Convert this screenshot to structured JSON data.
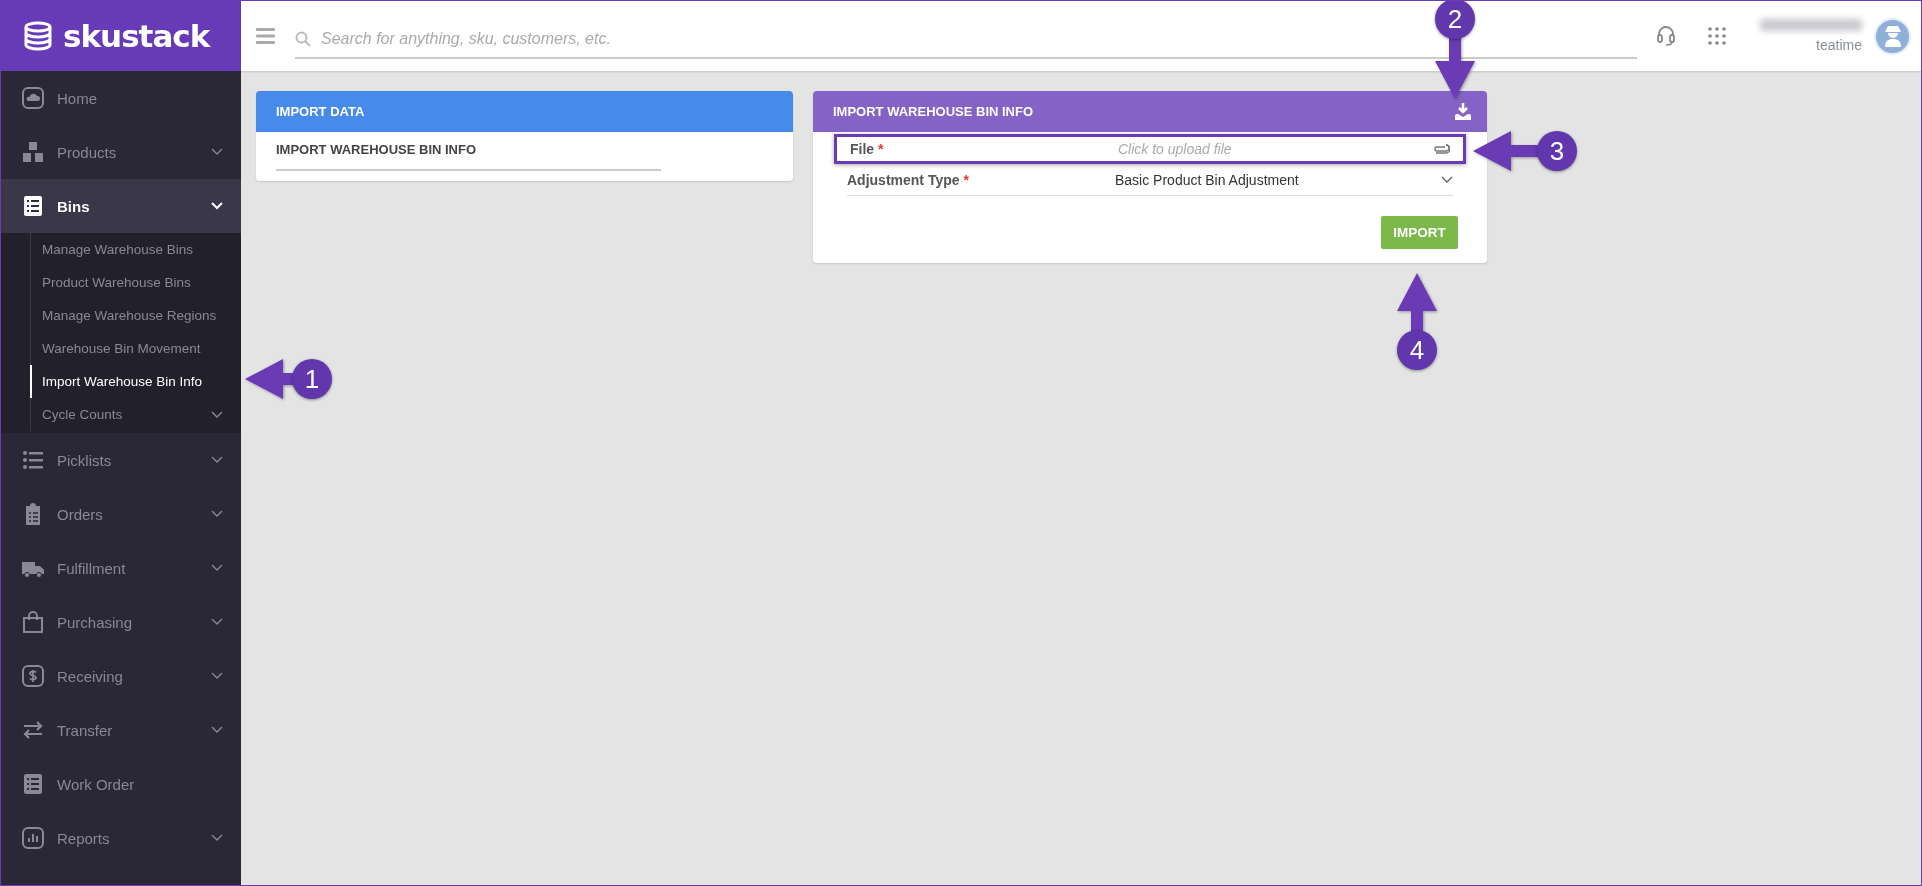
{
  "sidebar": {
    "logo": "skustack",
    "items": [
      {
        "label": "Home",
        "kind": "home",
        "expandable": false,
        "expanded": false
      },
      {
        "label": "Products",
        "kind": "products",
        "expandable": true,
        "expanded": false
      },
      {
        "label": "Bins",
        "kind": "bins",
        "expandable": true,
        "expanded": true,
        "children": [
          {
            "label": "Manage Warehouse Bins",
            "selected": false,
            "expandable": false
          },
          {
            "label": "Product Warehouse Bins",
            "selected": false,
            "expandable": false
          },
          {
            "label": "Manage Warehouse Regions",
            "selected": false,
            "expandable": false
          },
          {
            "label": "Warehouse Bin Movement",
            "selected": false,
            "expandable": false
          },
          {
            "label": "Import Warehouse Bin Info",
            "selected": true,
            "expandable": false
          },
          {
            "label": "Cycle Counts",
            "selected": false,
            "expandable": true
          }
        ]
      },
      {
        "label": "Picklists",
        "kind": "picklists",
        "expandable": true,
        "expanded": false
      },
      {
        "label": "Orders",
        "kind": "orders",
        "expandable": true,
        "expanded": false
      },
      {
        "label": "Fulfillment",
        "kind": "fulfillment",
        "expandable": true,
        "expanded": false
      },
      {
        "label": "Purchasing",
        "kind": "purchasing",
        "expandable": true,
        "expanded": false
      },
      {
        "label": "Receiving",
        "kind": "receiving",
        "expandable": true,
        "expanded": false
      },
      {
        "label": "Transfer",
        "kind": "transfer",
        "expandable": true,
        "expanded": false
      },
      {
        "label": "Work Order",
        "kind": "work_order",
        "expandable": false,
        "expanded": false
      },
      {
        "label": "Reports",
        "kind": "reports",
        "expandable": true,
        "expanded": false
      }
    ]
  },
  "header": {
    "search": {
      "placeholder": "Search for anything, sku, customers, etc."
    },
    "user": {
      "organization": "teatime"
    }
  },
  "import_data_card": {
    "title": "IMPORT DATA",
    "items": [
      {
        "label": "IMPORT WAREHOUSE BIN INFO",
        "selected": true
      }
    ]
  },
  "import_form_card": {
    "title": "IMPORT WAREHOUSE BIN INFO",
    "required_mark": "*",
    "fields": [
      {
        "label": "File",
        "required": true,
        "kind": "file",
        "placeholder": "Click to upload file",
        "highlighted": true
      },
      {
        "label": "Adjustment Type",
        "required": true,
        "kind": "select",
        "value": "Basic Product Bin Adjustment",
        "highlighted": false
      }
    ],
    "button": "IMPORT"
  },
  "annotations": [
    {
      "label": "1"
    },
    {
      "label": "2"
    },
    {
      "label": "3"
    },
    {
      "label": "4"
    }
  ]
}
